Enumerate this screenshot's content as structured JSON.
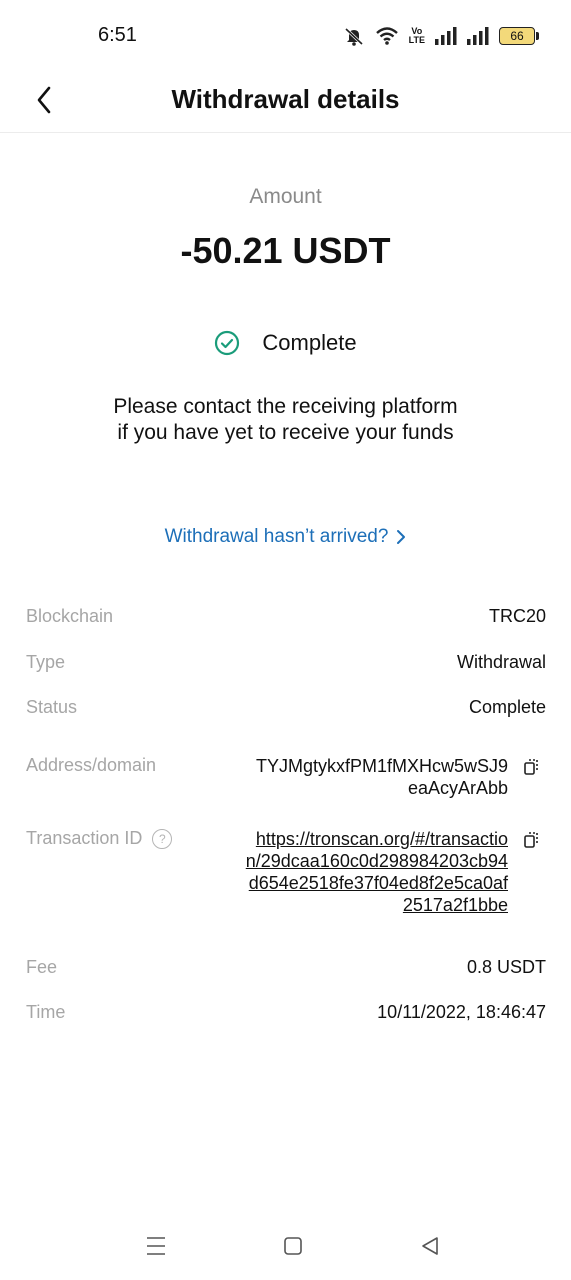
{
  "status_bar": {
    "time": "6:51",
    "battery": "66",
    "volte_top": "Vo",
    "volte_bottom": "LTE",
    "icons": [
      "mute-bell-icon",
      "wifi-icon",
      "volte-icon",
      "signal-1-icon",
      "signal-2-icon",
      "battery-icon"
    ]
  },
  "header": {
    "title": "Withdrawal details",
    "back_icon": "chevron-left-icon"
  },
  "summary": {
    "amount_label": "Amount",
    "amount_value": "-50.21 USDT",
    "status_text": "Complete",
    "status_color": "#1a9c7a",
    "notice_line1": "Please contact the receiving platform",
    "notice_line2": "if you have yet to receive your funds",
    "help_link": "Withdrawal hasn’t arrived?",
    "link_color": "#1d6fb8"
  },
  "details": {
    "blockchain": {
      "label": "Blockchain",
      "value": "TRC20"
    },
    "type": {
      "label": "Type",
      "value": "Withdrawal"
    },
    "status": {
      "label": "Status",
      "value": "Complete"
    },
    "address": {
      "label": "Address/domain",
      "value": "TYJMgtykxfPM1fMXHcw5wSJ9eaAcyArAbb"
    },
    "transaction": {
      "label": "Transaction ID",
      "help_icon": "?",
      "value": "https://tronscan.org/#/transaction/29dcaa160c0d298984203cb94d654e2518fe37f04ed8f2e5ca0af2517a2f1bbe"
    },
    "fee": {
      "label": "Fee",
      "value": "0.8 USDT"
    },
    "time": {
      "label": "Time",
      "value": "10/11/2022, 18:46:47"
    }
  },
  "nav_bar": {
    "icons": [
      "menu-icon",
      "home-square-icon",
      "back-triangle-icon"
    ]
  }
}
